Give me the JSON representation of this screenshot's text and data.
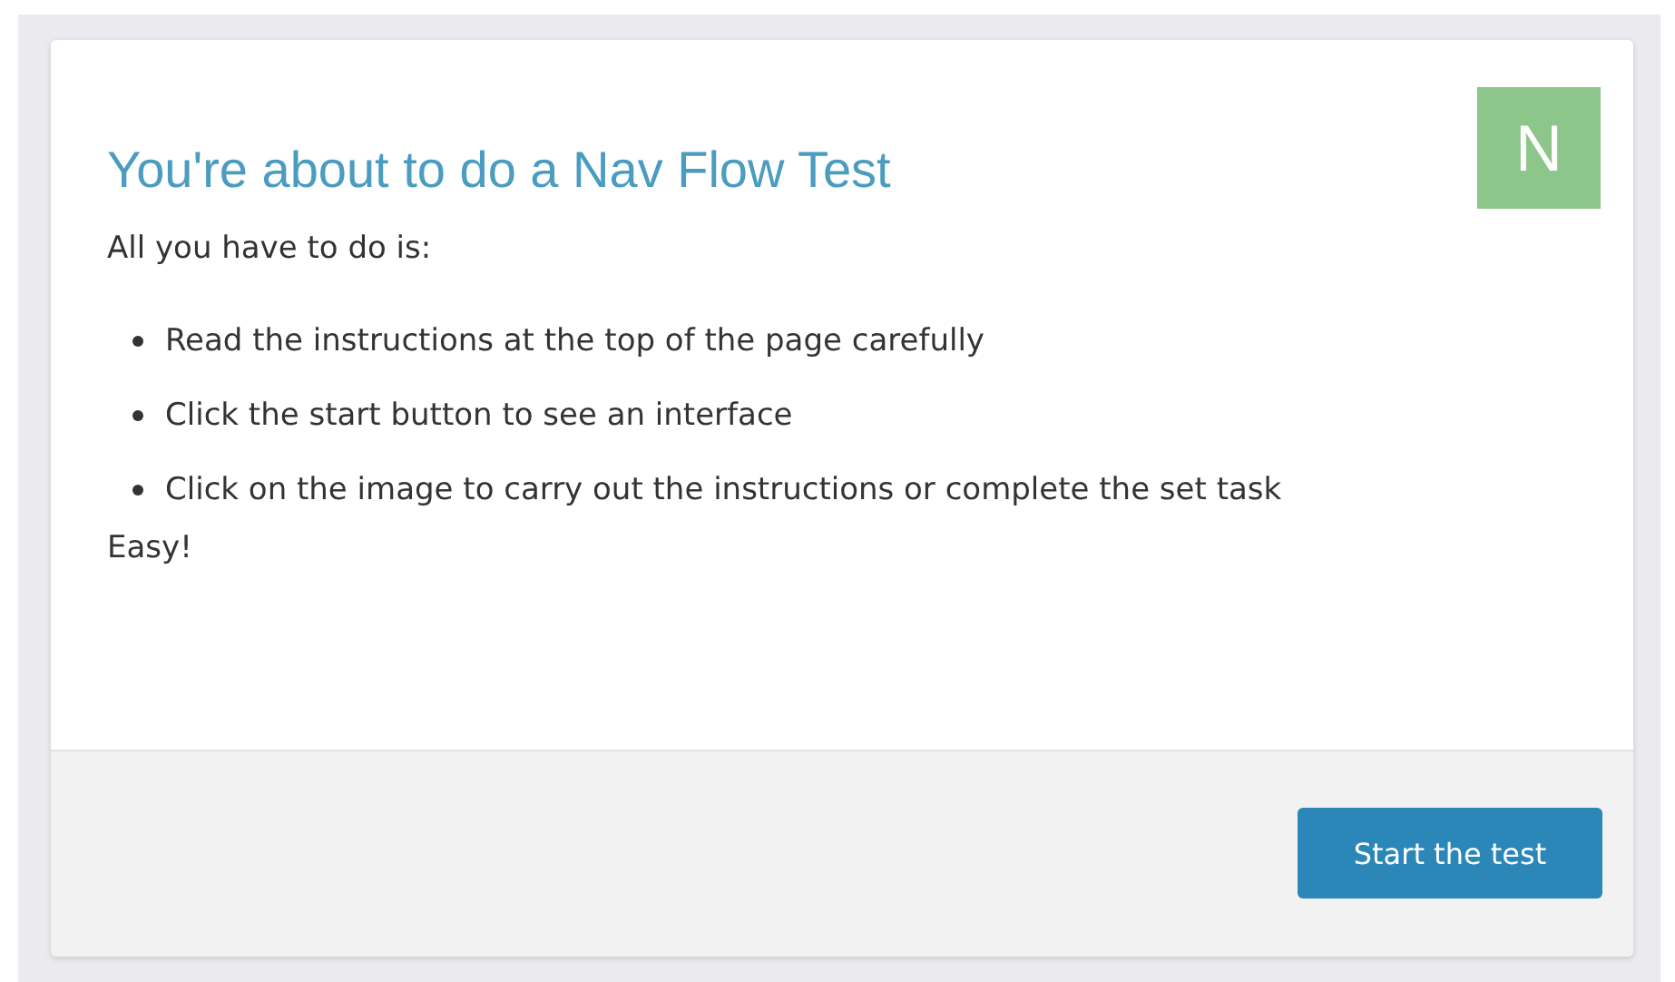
{
  "title": "You're about to do a Nav Flow Test",
  "badge": "N",
  "intro": "All you have to do is:",
  "steps": [
    "Read the instructions at the top of the page carefully",
    "Click the start button to see an interface",
    "Click on the image to carry out the instructions or complete the set task"
  ],
  "outro": "Easy!",
  "button": "Start the test"
}
